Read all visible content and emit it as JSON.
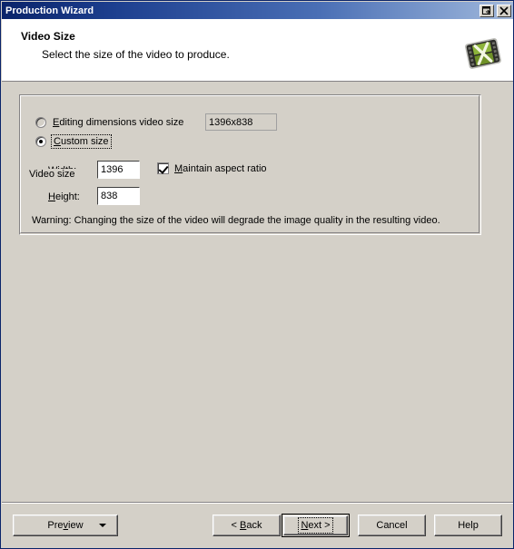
{
  "window": {
    "title": "Production Wizard",
    "titlebar_buttons": [
      {
        "name": "restore-icon",
        "tooltip": "Restore"
      },
      {
        "name": "close-icon",
        "tooltip": "Close"
      }
    ]
  },
  "header": {
    "title": "Video Size",
    "subtitle": "Select the size of the video to produce.",
    "icon": "camtasia-video-icon"
  },
  "group": {
    "legend": "Video size",
    "options": [
      {
        "id": "editing-dimensions",
        "label_pre": "",
        "accel": "E",
        "label_post": "diting dimensions video size",
        "full_label": "Editing dimensions video size",
        "selected": false,
        "enabled": false
      },
      {
        "id": "custom-size",
        "label_pre": "",
        "accel": "C",
        "label_post": "ustom size",
        "full_label": "Custom size",
        "selected": true,
        "enabled": true,
        "focused": true
      }
    ],
    "editing_dimensions_value": "1396x838",
    "fields": [
      {
        "id": "width",
        "accel": "W",
        "label_post": "idth:",
        "full_label": "Width:",
        "value": "1396"
      },
      {
        "id": "height",
        "accel": "H",
        "label_post": "eight:",
        "full_label": "Height:",
        "value": "838"
      }
    ],
    "maintain_aspect_ratio": {
      "accel": "M",
      "label_post": "aintain aspect ratio",
      "full_label": "Maintain aspect ratio",
      "checked": true
    },
    "warning": "Warning: Changing the size of the video will degrade the image quality in the resulting video."
  },
  "footer": {
    "preview": {
      "accel": "v",
      "pre": "Pre",
      "post": "iew",
      "full_label": "Preview",
      "has_dropdown": true
    },
    "back": {
      "pre": "< ",
      "accel": "B",
      "post": "ack",
      "full_label": "< Back"
    },
    "next": {
      "accel": "N",
      "post": "ext >",
      "pre": "",
      "full_label": "Next >",
      "is_default": true
    },
    "cancel": {
      "full_label": "Cancel"
    },
    "help": {
      "full_label": "Help"
    }
  },
  "colors": {
    "titlebar_start": "#0a246a",
    "titlebar_end": "#a6bada",
    "face": "#d4d0c8",
    "banner": "#ffffff",
    "text": "#000000",
    "icon_green": "#7fa432"
  }
}
